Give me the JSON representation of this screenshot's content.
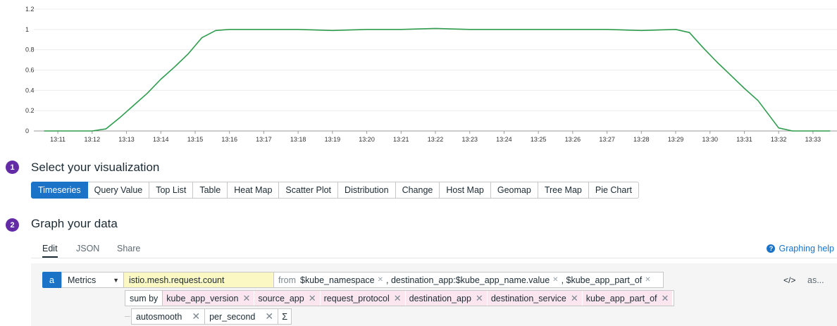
{
  "chart_data": {
    "type": "line",
    "title": "",
    "xlabel": "",
    "ylabel": "",
    "ylim": [
      0,
      1.2
    ],
    "y_ticks": [
      "0",
      "0.2",
      "0.4",
      "0.6",
      "0.8",
      "1",
      "1.2"
    ],
    "x_ticks": [
      "13:11",
      "13:12",
      "13:13",
      "13:14",
      "13:15",
      "13:16",
      "13:17",
      "13:18",
      "13:19",
      "13:20",
      "13:21",
      "13:22",
      "13:23",
      "13:24",
      "13:25",
      "13:26",
      "13:27",
      "13:28",
      "13:29",
      "13:30",
      "13:31",
      "13:32",
      "13:33"
    ],
    "grid": true,
    "series": [
      {
        "color": "#2e9c4d",
        "x": [
          "13:10.6",
          "13:11",
          "13:12",
          "13:12.4",
          "13:12.8",
          "13:13.2",
          "13:13.6",
          "13:14",
          "13:14.4",
          "13:14.8",
          "13:15.2",
          "13:15.6",
          "13:16",
          "13:17",
          "13:18",
          "13:19",
          "13:20",
          "13:21",
          "13:22",
          "13:23",
          "13:24",
          "13:25",
          "13:26",
          "13:27",
          "13:28",
          "13:29",
          "13:29.4",
          "13:29.8",
          "13:30.2",
          "13:30.6",
          "13:31",
          "13:31.4",
          "13:31.8",
          "13:32",
          "13:32.4",
          "13:33",
          "13:33.5"
        ],
        "values": [
          0,
          0,
          0,
          0.02,
          0.13,
          0.25,
          0.37,
          0.51,
          0.63,
          0.76,
          0.92,
          0.99,
          1.0,
          1.0,
          1.0,
          0.99,
          1.0,
          1.0,
          1.01,
          1.0,
          1.0,
          1.0,
          1.0,
          1.0,
          0.99,
          1.0,
          0.97,
          0.82,
          0.68,
          0.55,
          0.42,
          0.3,
          0.12,
          0.03,
          0,
          0,
          0
        ]
      }
    ]
  },
  "steps": {
    "visualization": {
      "number": "1",
      "title": "Select your visualization"
    },
    "graph": {
      "number": "2",
      "title": "Graph your data"
    }
  },
  "viz_types": [
    "Timeseries",
    "Query Value",
    "Top List",
    "Table",
    "Heat Map",
    "Scatter Plot",
    "Distribution",
    "Change",
    "Host Map",
    "Geomap",
    "Tree Map",
    "Pie Chart"
  ],
  "viz_selected": "Timeseries",
  "tabs": {
    "edit": "Edit",
    "json": "JSON",
    "share": "Share"
  },
  "help": {
    "label": "Graphing help",
    "icon": "question-circle-icon"
  },
  "query": {
    "letter": "a",
    "source": "Metrics",
    "metric": "istio.mesh.request.count",
    "from_label": "from",
    "filters": [
      "$kube_namespace",
      ", destination_app:$kube_app_name.value",
      ", $kube_app_part_of"
    ],
    "sum_by_label": "sum by",
    "group_by": [
      "kube_app_version",
      "source_app",
      "request_protocol",
      "destination_app",
      "destination_service",
      "kube_app_part_of"
    ],
    "functions": [
      "autosmooth",
      "per_second"
    ],
    "sigma": "Σ",
    "code_toggle": "</>",
    "as_label": "as..."
  }
}
